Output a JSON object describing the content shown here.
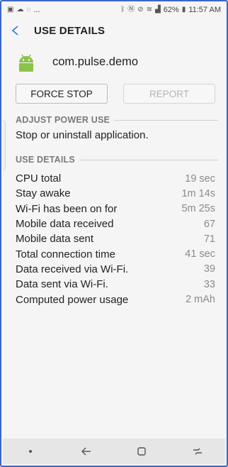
{
  "status_bar": {
    "left_icons": [
      "image-icon",
      "cloud-icon",
      "whatsapp-icon"
    ],
    "ellipsis": "...",
    "right_icons": [
      "bluetooth-icon",
      "nfc-icon",
      "mute-icon",
      "wifi-icon",
      "signal-icon"
    ],
    "battery": "62%",
    "time": "11:57 AM"
  },
  "app_bar": {
    "title": "USE DETAILS"
  },
  "app": {
    "name": "com.pulse.demo",
    "icon": "android-icon",
    "icon_color": "#8bc34a"
  },
  "buttons": {
    "force_stop": "FORCE STOP",
    "report": "REPORT"
  },
  "sections": {
    "adjust": "ADJUST POWER USE",
    "adjust_text": "Stop or uninstall application.",
    "details": "USE DETAILS"
  },
  "details": [
    {
      "label": "CPU total",
      "value": "19 sec"
    },
    {
      "label": "Stay awake",
      "value": "1m 14s"
    },
    {
      "label": "Wi-Fi has been on for",
      "value": "5m 25s"
    },
    {
      "label": "Mobile data received",
      "value": "67"
    },
    {
      "label": "Mobile data sent",
      "value": "71"
    },
    {
      "label": "Total connection time",
      "value": "41 sec"
    },
    {
      "label": "Data received via Wi-Fi.",
      "value": "39"
    },
    {
      "label": "Data sent via Wi-Fi.",
      "value": "33"
    },
    {
      "label": "Computed power usage",
      "value": "2 mAh"
    }
  ],
  "colors": {
    "accent": "#3e7fd0",
    "frame": "#3b67c9"
  }
}
